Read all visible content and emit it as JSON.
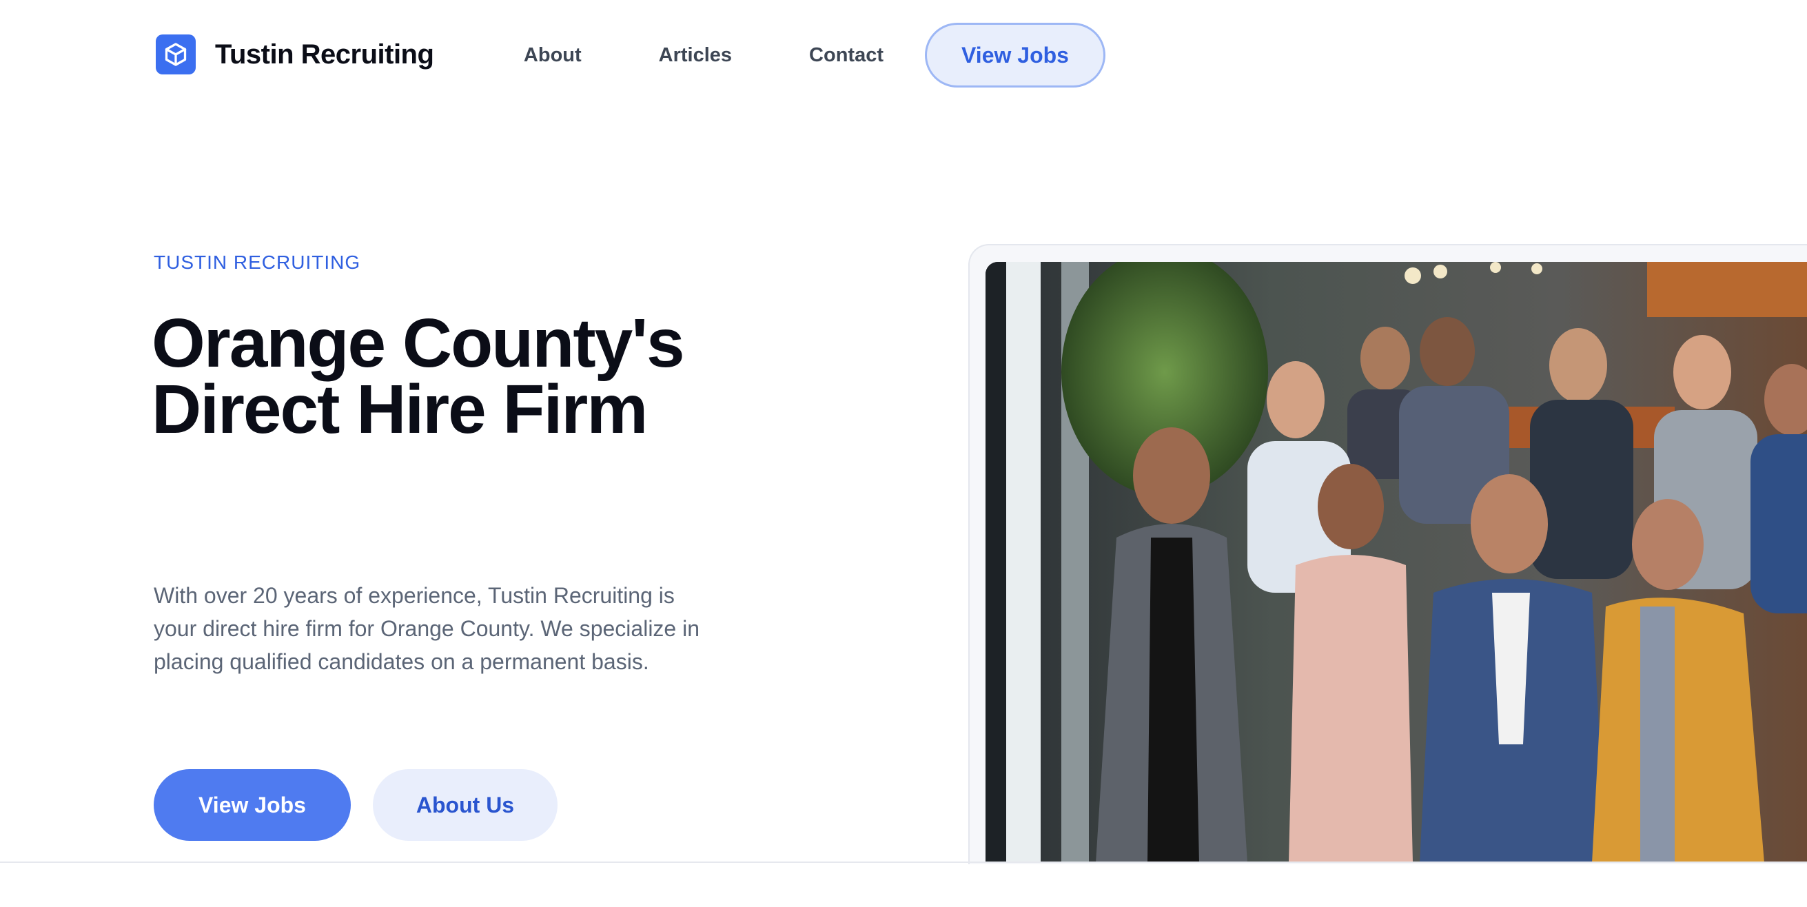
{
  "brand": {
    "name": "Tustin Recruiting",
    "logo_icon": "cube-icon",
    "accent": "#3b6ff0"
  },
  "nav": {
    "about": "About",
    "articles": "Articles",
    "contact": "Contact",
    "cta": "View Jobs"
  },
  "hero": {
    "eyebrow": "TUSTIN RECRUITING",
    "headline_line1": "Orange County's",
    "headline_line2": "Direct Hire Firm",
    "lede": "With over 20 years of experience, Tustin Recruiting is your direct hire firm for Orange County. We specialize in placing qualified candidates on a permanent basis.",
    "primary_button": "View Jobs",
    "secondary_button": "About Us"
  },
  "colors": {
    "primary": "#4f7bf0",
    "primary_text": "#2f5fe0",
    "heading": "#0b0d17",
    "body_text": "#5b6576"
  }
}
